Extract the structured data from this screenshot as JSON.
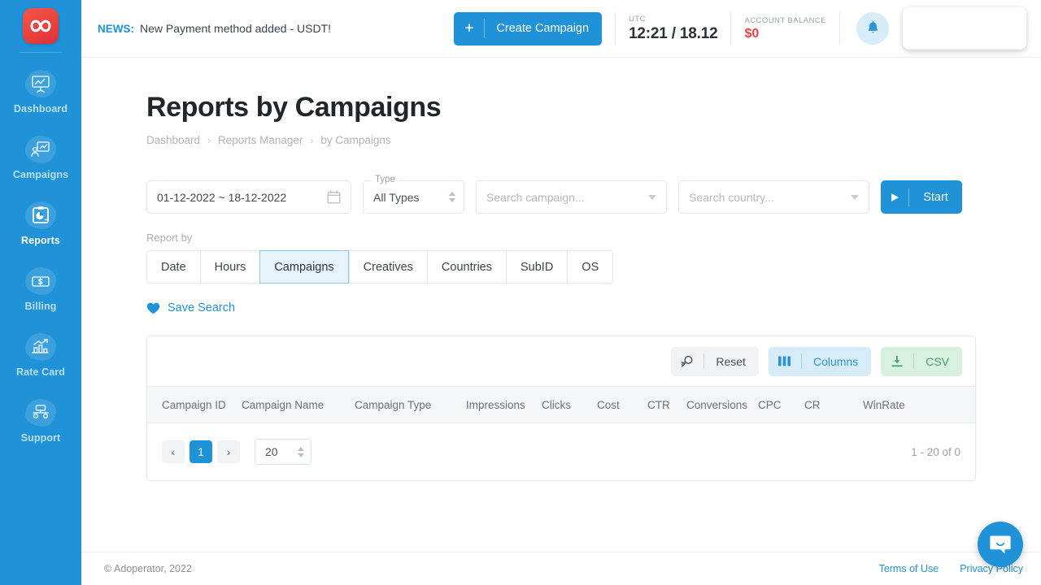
{
  "sidebar": {
    "logo_name": "adoperator-logo",
    "items": [
      {
        "label": "Dashboard",
        "icon": "presentation-chart-icon",
        "active": false
      },
      {
        "label": "Campaigns",
        "icon": "campaign-chart-icon",
        "active": false
      },
      {
        "label": "Reports",
        "icon": "clipboard-piechart-icon",
        "active": true
      },
      {
        "label": "Billing",
        "icon": "banknote-icon",
        "active": false
      },
      {
        "label": "Rate Card",
        "icon": "bar-chart-arrow-icon",
        "active": false
      },
      {
        "label": "Support",
        "icon": "headset-support-icon",
        "active": false
      }
    ]
  },
  "topbar": {
    "news_tag": "NEWS:",
    "news_text": "New Payment method added - USDT!",
    "create_campaign_label": "Create Campaign",
    "create_campaign_plus": "+",
    "utc_caption": "UTC",
    "utc_time": "12:21 / 18.12",
    "balance_caption": "ACCOUNT BALANCE",
    "balance_value": "$0"
  },
  "page": {
    "title": "Reports by Campaigns",
    "breadcrumb": [
      "Dashboard",
      "Reports Manager",
      "by Campaigns"
    ],
    "breadcrumb_separator": "›"
  },
  "filters": {
    "date_range": "01-12-2022 ~ 18-12-2022",
    "type_legend": "Type",
    "type_value": "All Types",
    "campaign_placeholder": "Search campaign...",
    "country_placeholder": "Search country...",
    "start_label": "Start"
  },
  "report_by": {
    "label": "Report by",
    "tabs": [
      {
        "label": "Date",
        "active": false
      },
      {
        "label": "Hours",
        "active": false
      },
      {
        "label": "Campaigns",
        "active": true
      },
      {
        "label": "Creatives",
        "active": false
      },
      {
        "label": "Countries",
        "active": false
      },
      {
        "label": "SubID",
        "active": false
      },
      {
        "label": "OS",
        "active": false
      }
    ],
    "save_search_label": "Save Search"
  },
  "table": {
    "toolbar": {
      "reset_label": "Reset",
      "columns_label": "Columns",
      "csv_label": "CSV"
    },
    "columns": [
      "Campaign ID",
      "Campaign Name",
      "Campaign Type",
      "Impressions",
      "Clicks",
      "Cost",
      "CTR",
      "Conversions",
      "CPC",
      "CR",
      "WinRate"
    ],
    "rows": [],
    "pagination": {
      "prev_label": "‹",
      "next_label": "›",
      "current_page": "1",
      "per_page": "20",
      "range_text": "1 - 20 of 0"
    }
  },
  "footer": {
    "copyright": "© Adoperator, 2022",
    "links": [
      "Terms of Use",
      "Privacy Policy"
    ]
  },
  "colors": {
    "brand_blue": "#1f92d8",
    "sidebar_blue": "#1f92d8",
    "logo_red": "#e8403c",
    "balance_red": "#e8443c",
    "csv_green": "#46a06a",
    "header_gray": "#f4f6f7"
  }
}
